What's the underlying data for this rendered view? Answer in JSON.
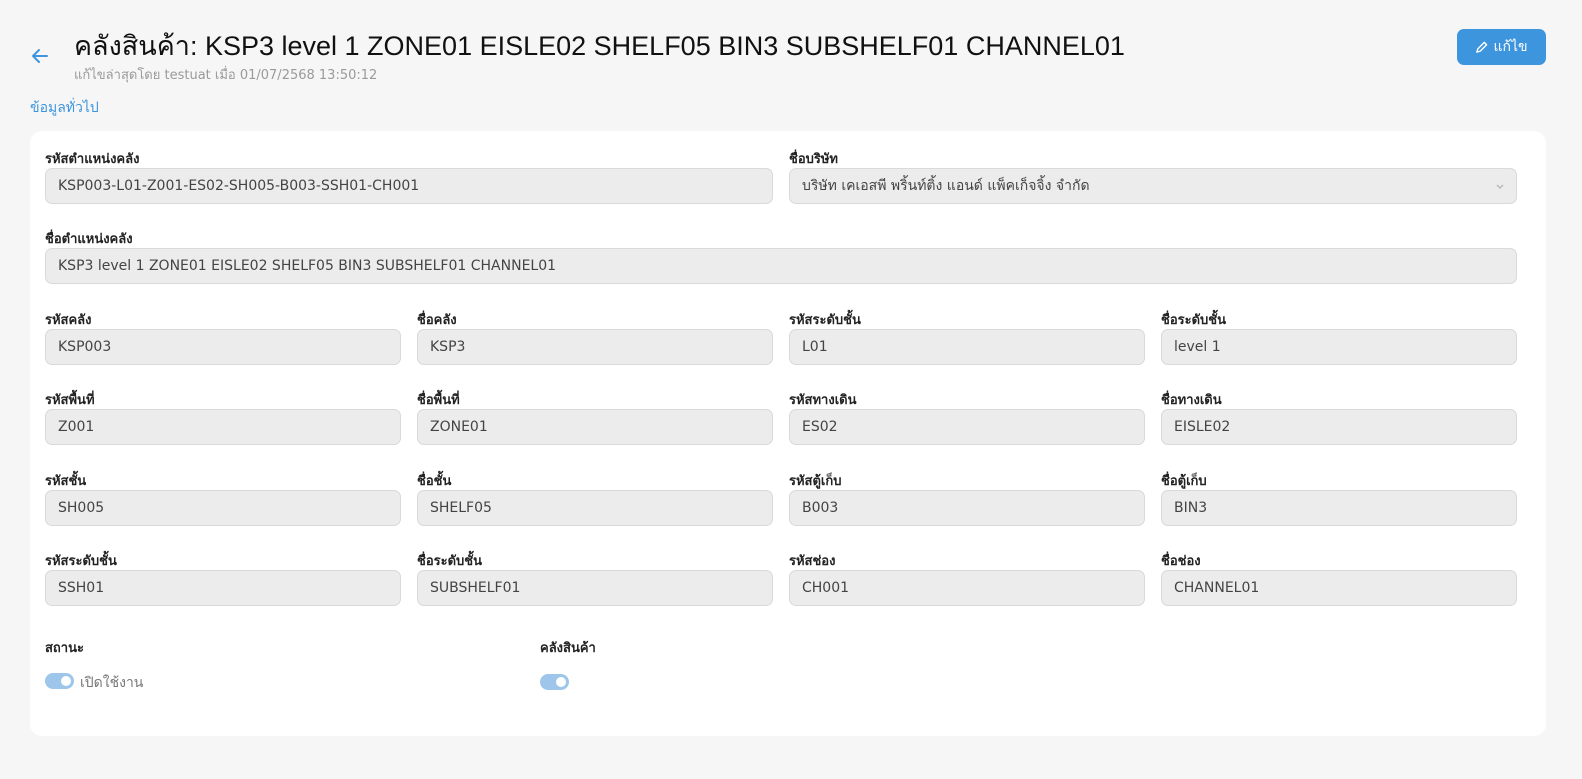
{
  "header": {
    "title": "คลังสินค้า: KSP3 level 1 ZONE01 EISLE02 SHELF05 BIN3 SUBSHELF01 CHANNEL01",
    "subtitle": "แก้ไขล่าสุดโดย testuat เมื่อ 01/07/2568 13:50:12",
    "edit_label": "แก้ไข",
    "back_icon": "arrow-left-icon",
    "edit_icon": "pencil-icon"
  },
  "section_label": "ข้อมูลทั่วไป",
  "form": {
    "location_code": {
      "label": "รหัสตำแหน่งคลัง",
      "value": "KSP003-L01-Z001-ES02-SH005-B003-SSH01-CH001"
    },
    "company_name": {
      "label": "ชื่อบริษัท",
      "value": "บริษัท เคเอสพี พริ้นท์ติ้ง แอนด์ แพ็คเก็จจิ้ง จำกัด"
    },
    "location_name": {
      "label": "ชื่อตำแหน่งคลัง",
      "value": "KSP3 level 1 ZONE01 EISLE02 SHELF05 BIN3 SUBSHELF01 CHANNEL01"
    },
    "warehouse_code": {
      "label": "รหัสคลัง",
      "value": "KSP003"
    },
    "warehouse_name": {
      "label": "ชื่อคลัง",
      "value": "KSP3"
    },
    "level_code": {
      "label": "รหัสระดับชั้น",
      "value": "L01"
    },
    "level_name": {
      "label": "ชื่อระดับชั้น",
      "value": "level 1"
    },
    "zone_code": {
      "label": "รหัสพื้นที่",
      "value": "Z001"
    },
    "zone_name": {
      "label": "ชื่อพื้นที่",
      "value": "ZONE01"
    },
    "aisle_code": {
      "label": "รหัสทางเดิน",
      "value": "ES02"
    },
    "aisle_name": {
      "label": "ชื่อทางเดิน",
      "value": "EISLE02"
    },
    "shelf_code": {
      "label": "รหัสชั้น",
      "value": "SH005"
    },
    "shelf_name": {
      "label": "ชื่อชั้น",
      "value": "SHELF05"
    },
    "bin_code": {
      "label": "รหัสตู้เก็บ",
      "value": "B003"
    },
    "bin_name": {
      "label": "ชื่อตู้เก็บ",
      "value": "BIN3"
    },
    "subshelf_code": {
      "label": "รหัสระดับชั้น",
      "value": "SSH01"
    },
    "subshelf_name": {
      "label": "ชื่อระดับชั้น",
      "value": "SUBSHELF01"
    },
    "channel_code": {
      "label": "รหัสช่อง",
      "value": "CH001"
    },
    "channel_name": {
      "label": "ชื่อช่อง",
      "value": "CHANNEL01"
    },
    "status": {
      "label": "สถานะ",
      "toggle_text": "เปิดใช้งาน",
      "enabled": true
    },
    "warehouse_flag": {
      "label": "คลังสินค้า",
      "enabled": true
    }
  },
  "colors": {
    "accent": "#3d95dd",
    "toggle_on": "#9ec6eb",
    "field_bg": "#ececec",
    "page_bg": "#f6f6f6"
  }
}
